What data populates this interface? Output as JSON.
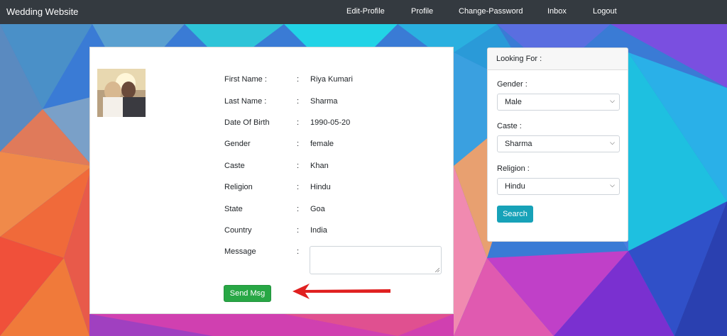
{
  "navbar": {
    "brand": "Wedding Website",
    "links": [
      "Edit-Profile",
      "Profile",
      "Change-Password",
      "Inbox",
      "Logout"
    ]
  },
  "profile": {
    "fields": [
      {
        "label": "First Name :",
        "value": "Riya Kumari"
      },
      {
        "label": "Last Name :",
        "value": "Sharma"
      },
      {
        "label": "Date Of Birth",
        "value": "1990-05-20"
      },
      {
        "label": "Gender",
        "value": "female"
      },
      {
        "label": "Caste",
        "value": "Khan"
      },
      {
        "label": "Religion",
        "value": "Hindu"
      },
      {
        "label": "State",
        "value": "Goa"
      },
      {
        "label": "Country",
        "value": "India"
      }
    ],
    "colon": ":",
    "message_label": "Message",
    "message_value": "",
    "send_button": "Send Msg"
  },
  "search_panel": {
    "title": "Looking For :",
    "gender_label": "Gender :",
    "gender_value": "Male",
    "caste_label": "Caste :",
    "caste_value": "Sharma",
    "religion_label": "Religion :",
    "religion_value": "Hindu",
    "search_button": "Search"
  },
  "colors": {
    "navbar": "#343a40",
    "send_button": "#28a745",
    "search_button": "#17a2b8",
    "arrow": "#e02020"
  },
  "icons": [
    "profile-photo",
    "chevron-down-icon",
    "arrow-left-icon",
    "resize-grip-icon"
  ]
}
